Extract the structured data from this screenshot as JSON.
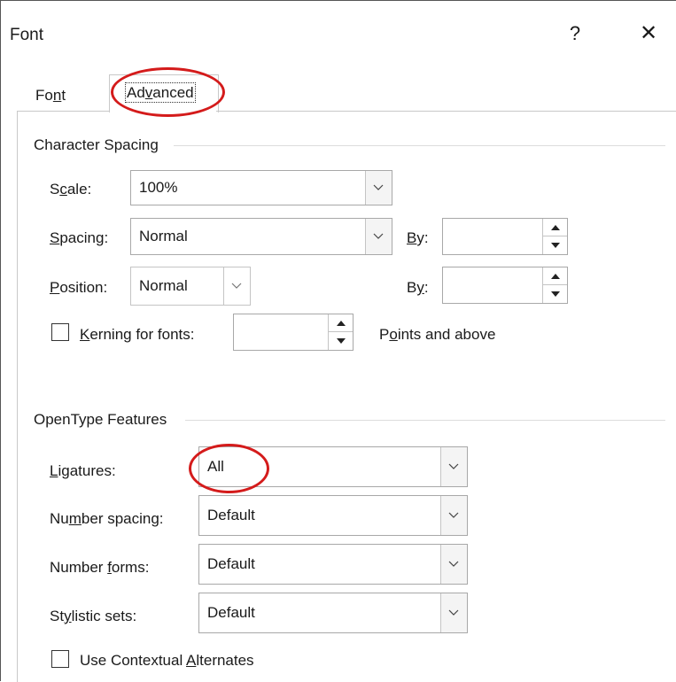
{
  "dialog": {
    "title": "Font",
    "help": "?",
    "close": "✕"
  },
  "tabs": [
    {
      "pre": "Fo",
      "key": "n",
      "post": "t"
    },
    {
      "pre": "Ad",
      "key": "v",
      "post": "anced"
    }
  ],
  "character_spacing": {
    "title": "Character Spacing",
    "scale": {
      "key": "S",
      "post": "c",
      "key2": "",
      "rest": "ale:",
      "label_pre": "S",
      "label_key": "c",
      "label_post": "ale:",
      "value": "100%"
    },
    "spacing": {
      "label_key": "S",
      "label_post": "pacing:",
      "value": "Normal",
      "by_key": "B",
      "by_post": "y:",
      "by_value": ""
    },
    "position": {
      "label_key": "P",
      "label_post": "osition:",
      "value": "Normal",
      "by_pre": "B",
      "by_key": "y",
      "by_post": ":",
      "by_value": ""
    },
    "kerning": {
      "label_key": "K",
      "label_post": "erning for fonts:",
      "value": "",
      "suffix_pre": "P",
      "suffix_key": "o",
      "suffix_post": "ints and above",
      "checked": false
    }
  },
  "opentype": {
    "title": "OpenType Features",
    "ligatures": {
      "label_key": "L",
      "label_post": "igatures:",
      "value": "All"
    },
    "number_spacing": {
      "label_pre": "Nu",
      "label_key": "m",
      "label_post": "ber spacing:",
      "value": "Default"
    },
    "number_forms": {
      "label_pre": "Number ",
      "label_key": "f",
      "label_post": "orms:",
      "value": "Default"
    },
    "stylistic_sets": {
      "label_pre": "St",
      "label_key": "y",
      "label_post": "listic sets:",
      "value": "Default"
    },
    "contextual": {
      "label_pre": "Use Contextual ",
      "label_key": "A",
      "label_post": "lternates",
      "checked": false
    }
  },
  "colors": {
    "annotation": "#d41b1b"
  }
}
